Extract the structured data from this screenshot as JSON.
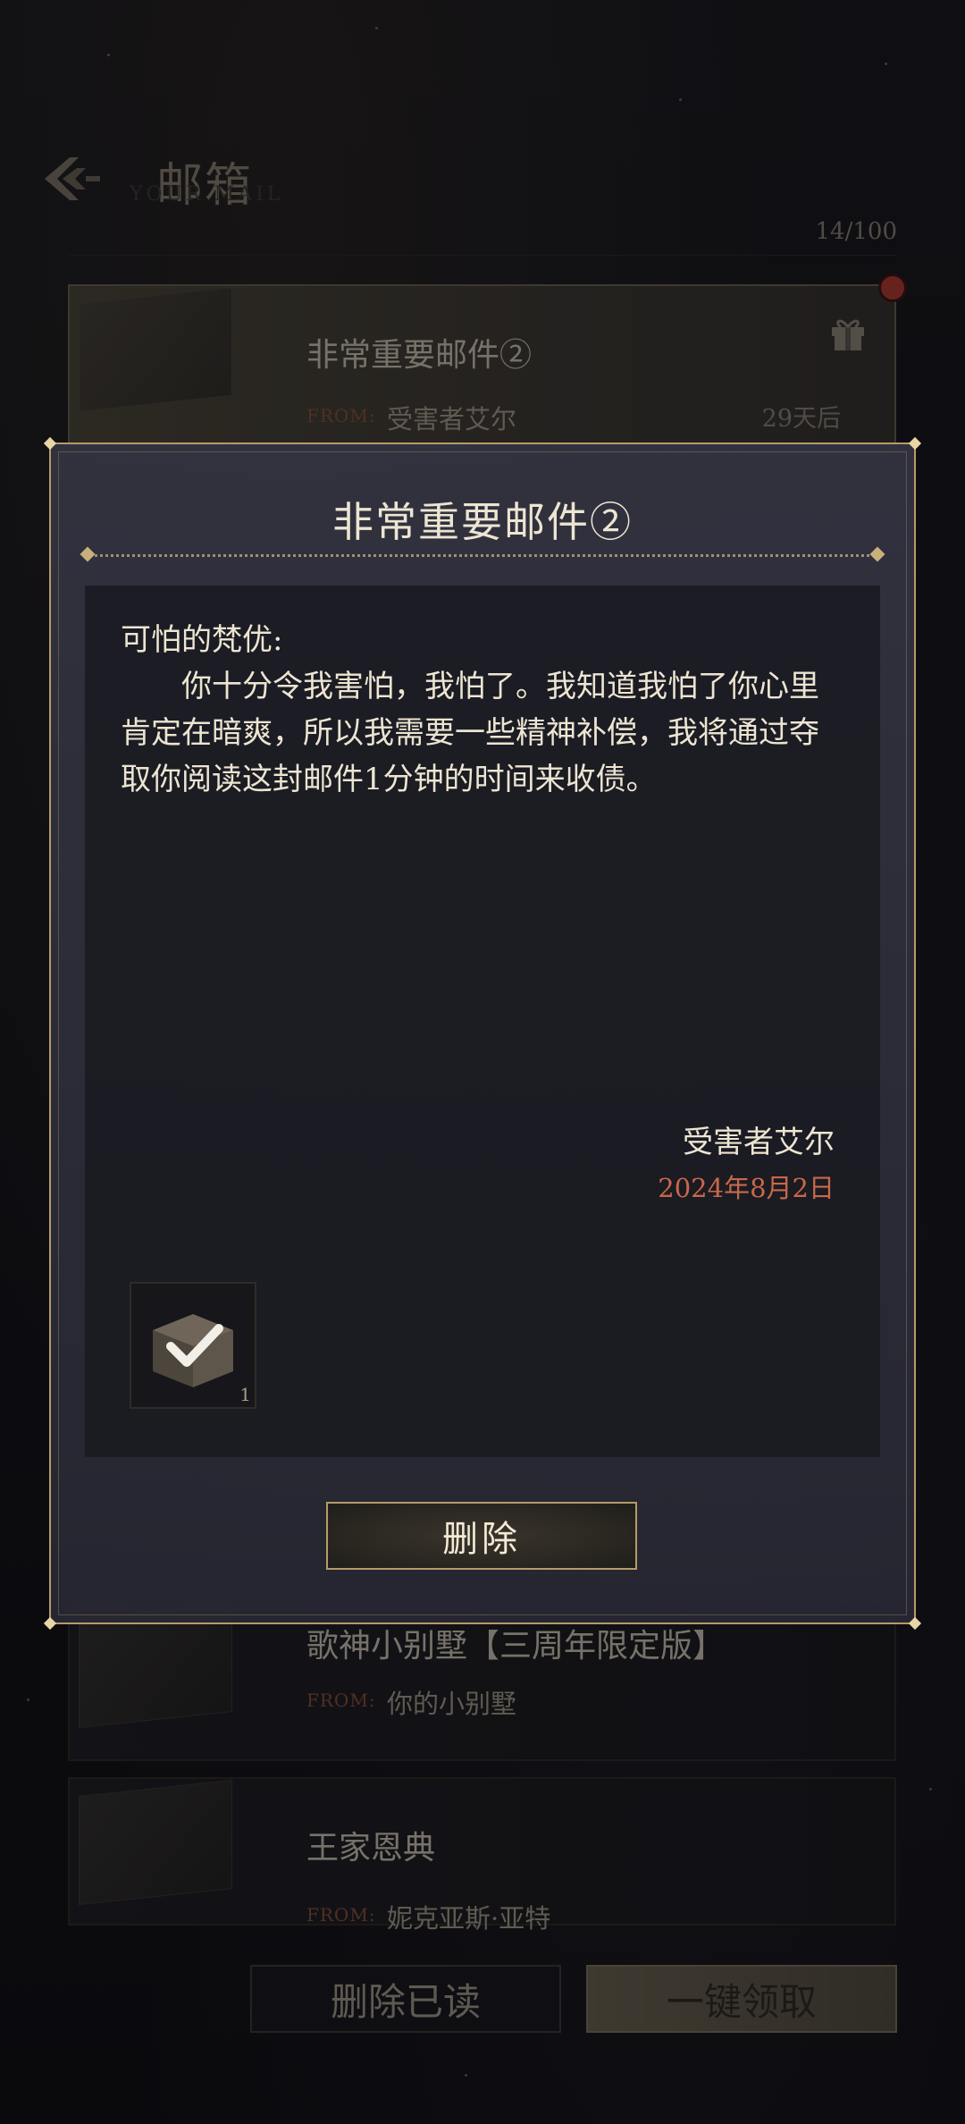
{
  "header": {
    "title": "邮箱",
    "subtitle": "YOUR MAIL",
    "count": "14/100"
  },
  "mails": [
    {
      "title": "非常重要邮件②",
      "from_tag": "FROM:",
      "from": "受害者艾尔",
      "days": "29天后",
      "has_gift": true,
      "unread": true
    },
    {
      "title": "歌神小别墅【三周年限定版】",
      "from_tag": "FROM:",
      "from": "你的小别墅"
    },
    {
      "title": "王家恩典",
      "from_tag": "FROM:",
      "from": "妮克亚斯·亚特"
    }
  ],
  "bottom": {
    "delete_read": "删除已读",
    "claim_all": "一键领取"
  },
  "modal": {
    "title": "非常重要邮件②",
    "greeting": "可怕的梵优:",
    "body": "你十分令我害怕，我怕了。我知道我怕了你心里肯定在暗爽，所以我需要一些精神补偿，我将通过夺取你阅读这封邮件1分钟的时间来收债。",
    "signature": "受害者艾尔",
    "date": "2024年8月2日",
    "item": {
      "qty": "1",
      "icon": "claimed-box-icon"
    },
    "delete_label": "删除"
  },
  "colors": {
    "accent_gold": "#b49b69",
    "date_red": "#c8684a"
  }
}
